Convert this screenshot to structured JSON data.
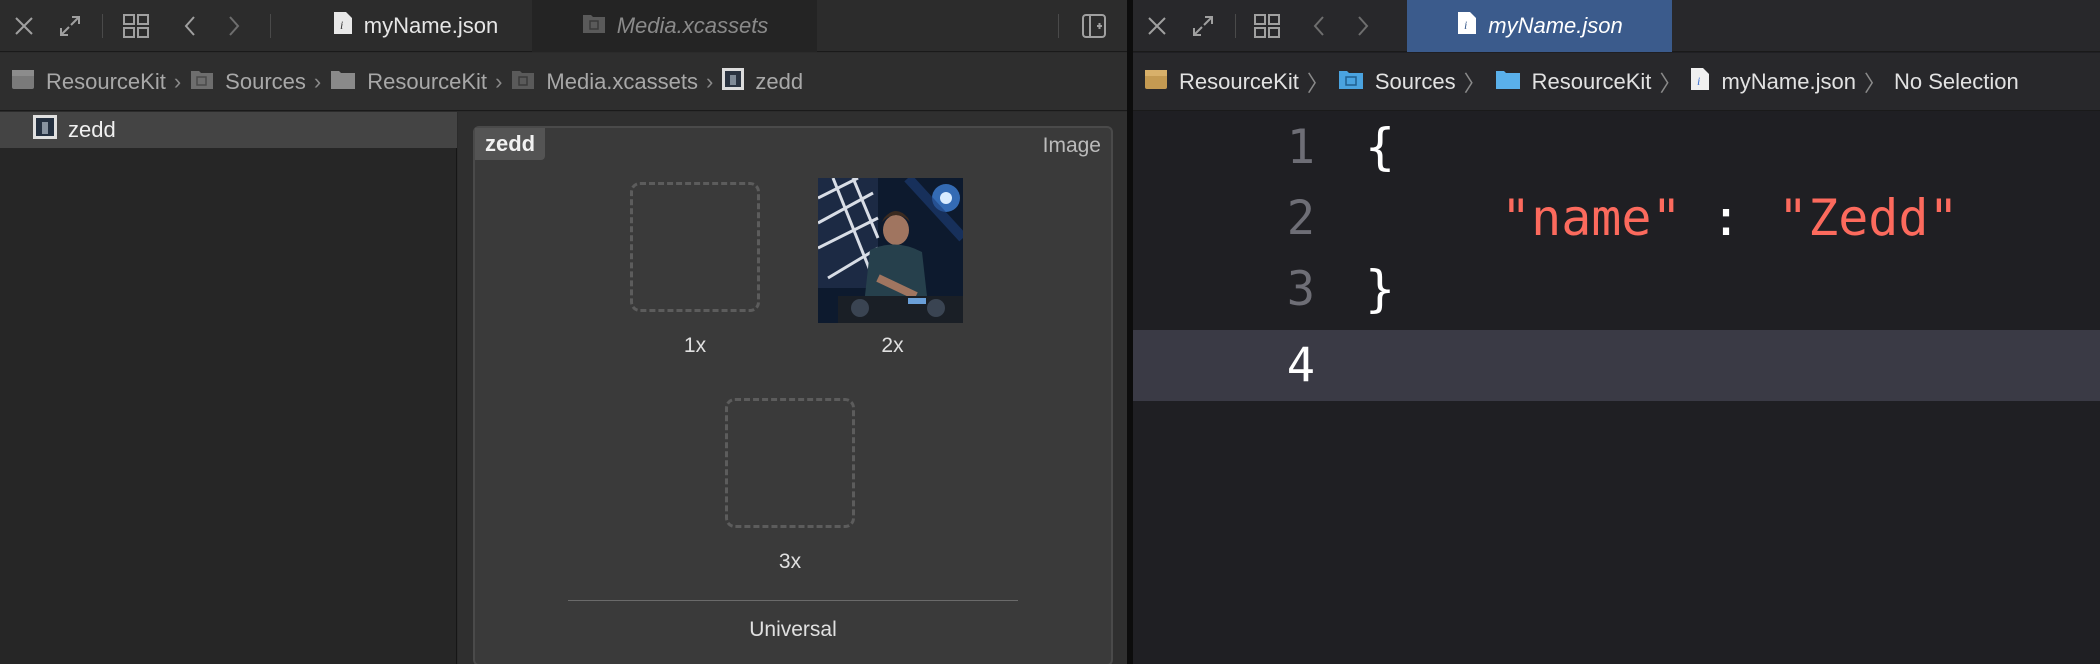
{
  "left_editor": {
    "tabs": [
      {
        "label": "myName.json",
        "state": "active"
      },
      {
        "label": "Media.xcassets",
        "state": "inactive"
      }
    ],
    "breadcrumbs": [
      "ResourceKit",
      "Sources",
      "ResourceKit",
      "Media.xcassets",
      "zedd"
    ],
    "sidebar": {
      "items": [
        {
          "label": "zedd",
          "selected": true
        }
      ]
    },
    "image_set": {
      "name": "zedd",
      "type_label": "Image",
      "slots": [
        {
          "label": "1x",
          "filled": false
        },
        {
          "label": "2x",
          "filled": true
        },
        {
          "label": "3x",
          "filled": false
        }
      ],
      "group_label": "Universal"
    }
  },
  "right_editor": {
    "tabs": [
      {
        "label": "myName.json",
        "state": "active"
      }
    ],
    "breadcrumbs": [
      "ResourceKit",
      "Sources",
      "ResourceKit",
      "myName.json",
      "No Selection"
    ],
    "code": {
      "lines": [
        {
          "number": "1",
          "text": "{"
        },
        {
          "number": "2",
          "key": "\"name\"",
          "colon": ":",
          "value": "\"Zedd\""
        },
        {
          "number": "3",
          "text": "}"
        },
        {
          "number": "4",
          "text": ""
        }
      ],
      "current_line": 4
    }
  },
  "colors": {
    "accent_blue": "#3b5b8c",
    "string_red": "#fc6a5d",
    "current_line_bg": "#3a3a45"
  }
}
